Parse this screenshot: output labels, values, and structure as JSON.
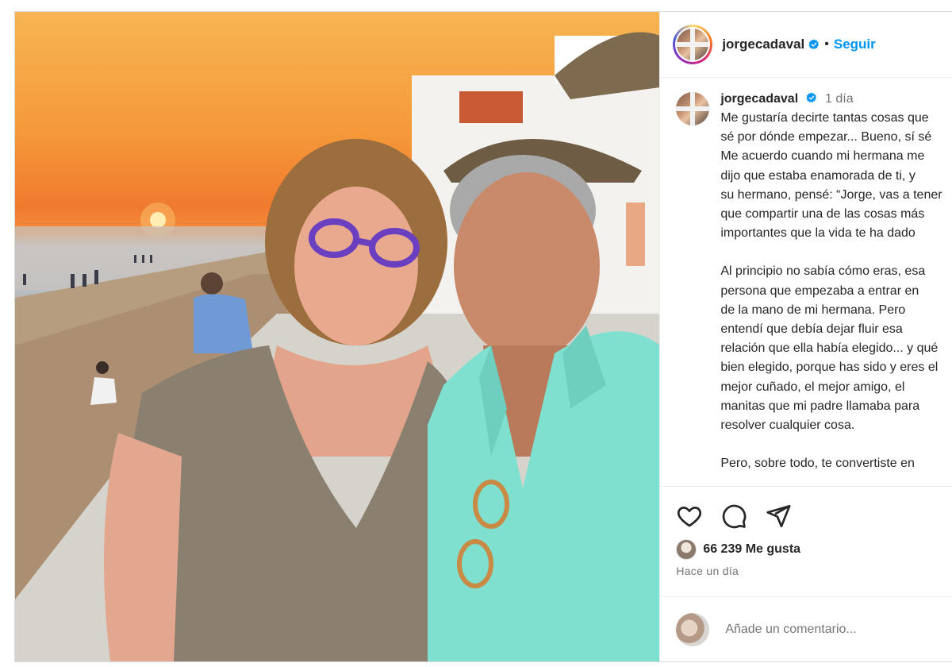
{
  "post": {
    "author": {
      "username": "jorgecadaval",
      "verified": true
    },
    "header": {
      "separator": "•",
      "follow_label": "Seguir"
    },
    "caption": {
      "time": "1 día",
      "paragraphs": [
        [
          "Me gustaría decirte tantas cosas que",
          "sé por dónde empezar... Bueno, sí sé",
          "Me acuerdo cuando mi hermana me",
          "dijo que estaba enamorada de ti, y",
          "su hermano, pensé: “Jorge, vas a tener",
          "que compartir una de las cosas más",
          "importantes que la vida te ha dado"
        ],
        [
          "Al principio no sabía cómo eras, esa",
          "persona que empezaba a entrar en",
          "de la mano de mi hermana. Pero",
          "entendí que debía dejar fluir esa",
          "relación que ella había elegido... y qué",
          "bien elegido, porque has sido y eres el",
          "mejor cuñado, el mejor amigo, el",
          "manitas que mi padre llamaba para",
          "resolver cualquier cosa."
        ],
        [
          "Pero, sobre todo, te convertiste en"
        ]
      ]
    },
    "likes": {
      "count_label": "66 239 Me gusta"
    },
    "posted_ago": "Hace un día",
    "comment": {
      "placeholder": "Añade un comentario..."
    },
    "icons": {
      "like": "heart-icon",
      "comment": "comment-bubble-icon",
      "share": "paper-plane-icon",
      "verified": "verified-badge-icon"
    },
    "colors": {
      "follow_blue": "#0095f6",
      "verified_blue": "#0095f6",
      "muted_text": "#737373"
    }
  }
}
